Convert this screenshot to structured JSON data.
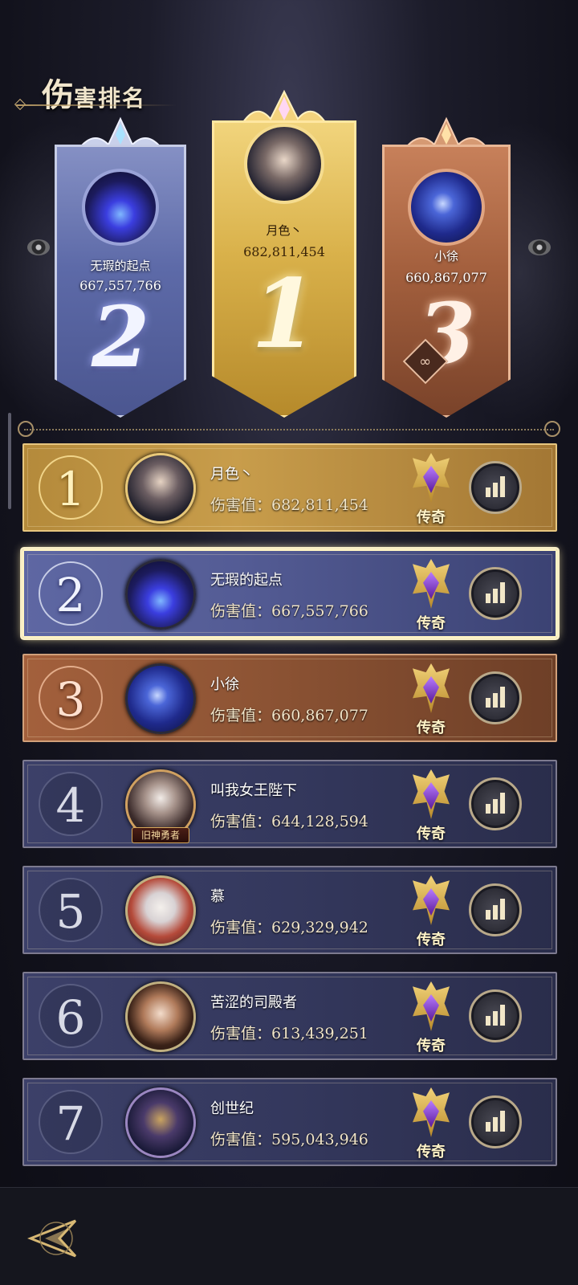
{
  "page": {
    "title_big": "伤",
    "title_rest": "害排名"
  },
  "podium": {
    "first": {
      "rank": "1",
      "name": "月色丶",
      "score": "682,811,454"
    },
    "second": {
      "rank": "2",
      "name": "无瑕的起点",
      "score": "667,557,766"
    },
    "third": {
      "rank": "3",
      "name": "小徐",
      "score": "660,867,077"
    }
  },
  "score_label": "伤害值：",
  "tier_label": "传奇",
  "avatar_badge_4": "旧神勇者",
  "rows": [
    {
      "rank": "1",
      "name": "月色丶",
      "score": "682,811,454",
      "tier": "传奇"
    },
    {
      "rank": "2",
      "name": "无瑕的起点",
      "score": "667,557,766",
      "tier": "传奇"
    },
    {
      "rank": "3",
      "name": "小徐",
      "score": "660,867,077",
      "tier": "传奇"
    },
    {
      "rank": "4",
      "name": "叫我女王陛下",
      "score": "644,128,594",
      "tier": "传奇"
    },
    {
      "rank": "5",
      "name": "慕",
      "score": "629,329,942",
      "tier": "传奇"
    },
    {
      "rank": "6",
      "name": "苦涩的司殿者",
      "score": "613,439,251",
      "tier": "传奇"
    },
    {
      "rank": "7",
      "name": "创世纪",
      "score": "595,043,946",
      "tier": "传奇"
    }
  ],
  "icons": {
    "stats": "bar-chart-icon",
    "back": "back-arrow-icon",
    "tier": "legend-tier-crest-icon"
  },
  "colors": {
    "gold": "#c89d4b",
    "silver": "#5e67a3",
    "bronze": "#a3603c",
    "default_row": "#3c4069",
    "highlight": "#f8eec6"
  }
}
